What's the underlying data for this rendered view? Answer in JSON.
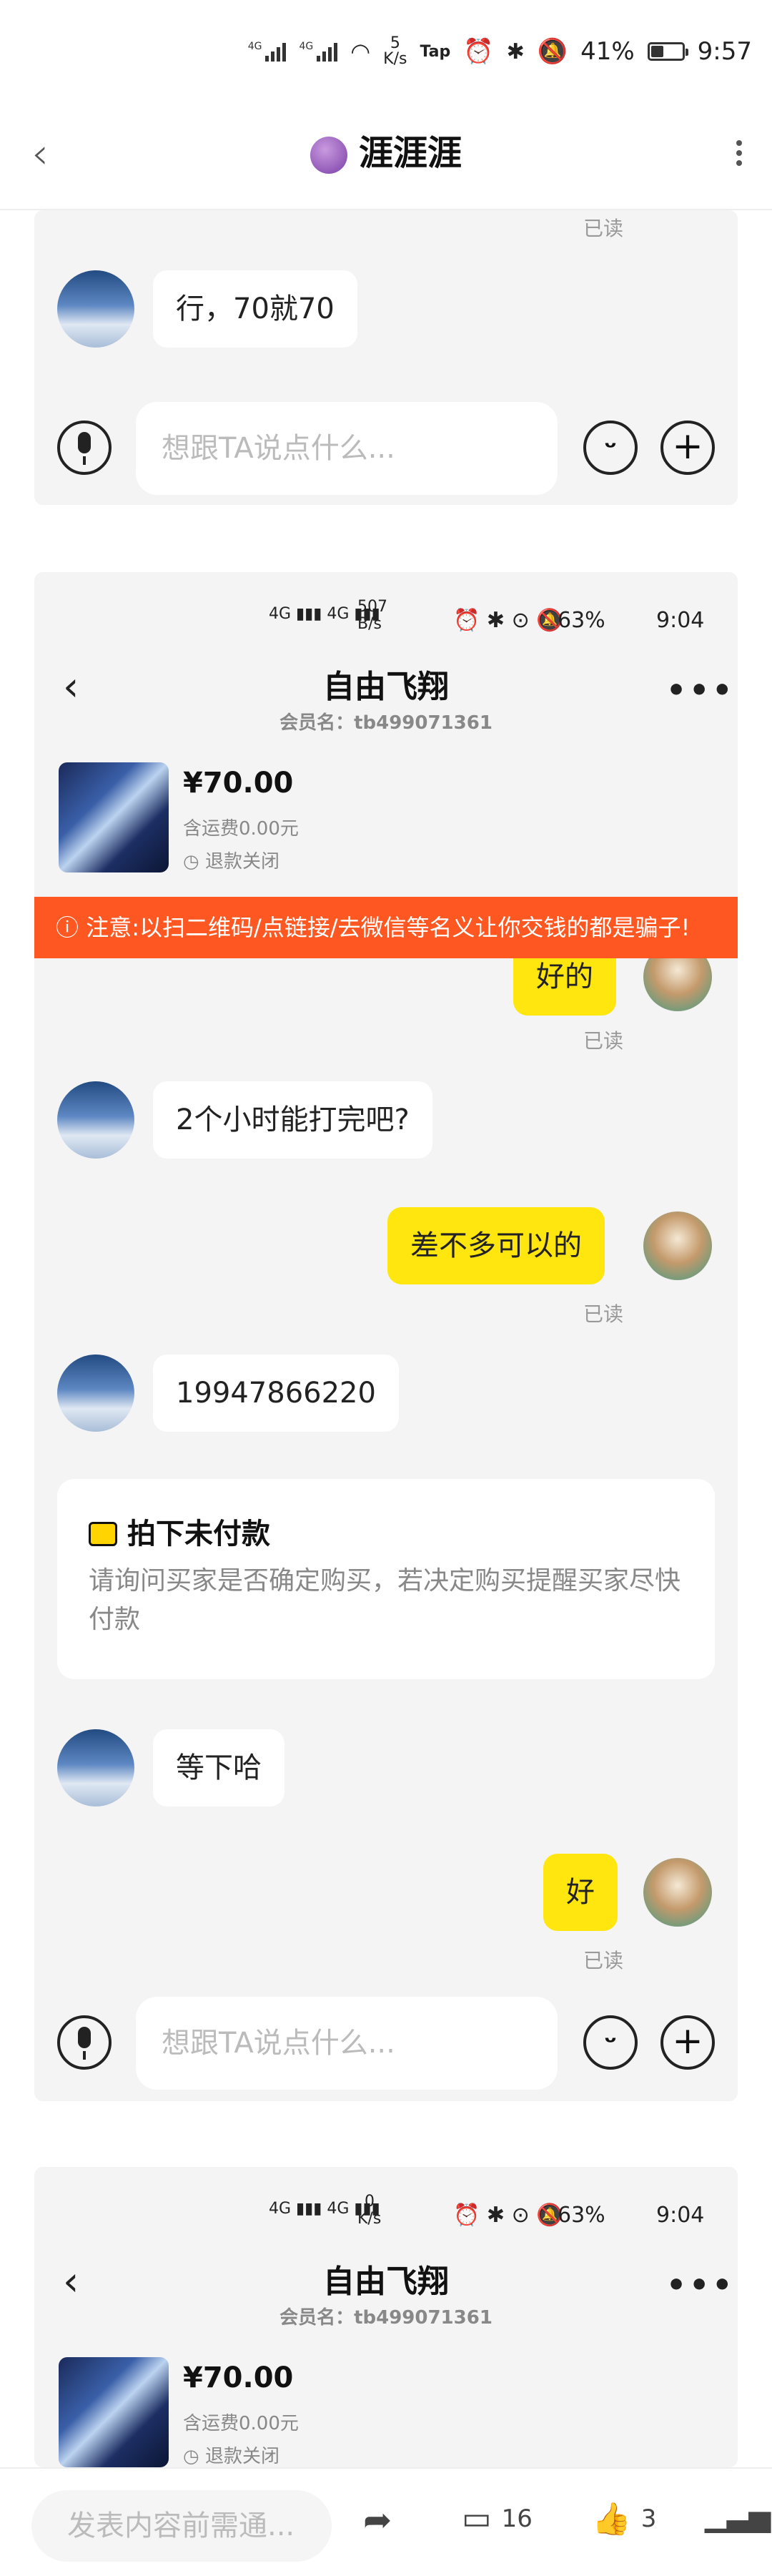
{
  "status_bar": {
    "net_speed_value": "5",
    "net_speed_unit": "K/s",
    "tap_label": "Tap",
    "battery": "41%",
    "time": "9:57",
    "battery_level": 0.41
  },
  "header": {
    "title": "涯涯涯"
  },
  "panel1": {
    "read_label": "已读",
    "message": "行，70就70",
    "input_placeholder": "想跟TA说点什么..."
  },
  "panel2": {
    "status": {
      "net_speed_value": "507",
      "net_speed_unit": "B/s",
      "battery": "63%",
      "time": "9:04"
    },
    "chat_title": "自由飞翔",
    "member_label": "会员名：tb499071361",
    "price": "¥70.00",
    "shipping": "含运费0.00元",
    "refund": "退款关闭",
    "warning": "注意:以扫二维码/点链接/去微信等名义让你交钱的都是骗子!",
    "messages": [
      {
        "side": "right",
        "text": "好的",
        "read": "已读"
      },
      {
        "side": "left",
        "text": "2个小时能打完吧?"
      },
      {
        "side": "right",
        "text": "差不多可以的",
        "read": "已读"
      },
      {
        "side": "left",
        "text": "19947866220"
      },
      {
        "side": "left",
        "text": "等下哈"
      },
      {
        "side": "right",
        "text": "好",
        "read": "已读"
      }
    ],
    "card": {
      "title": "拍下未付款",
      "text": "请询问买家是否确定购买，若决定购买提醒买家尽快付款"
    },
    "input_placeholder": "想跟TA说点什么..."
  },
  "panel3": {
    "status": {
      "net_speed_value": "0",
      "net_speed_unit": "K/s",
      "battery": "63%",
      "time": "9:04"
    },
    "chat_title": "自由飞翔",
    "member_label": "会员名：tb499071361",
    "price": "¥70.00",
    "shipping": "含运费0.00元",
    "refund": "退款关闭"
  },
  "bottom_bar": {
    "comment_placeholder": "发表内容前需通...",
    "comment_count": "16",
    "like_count": "3"
  }
}
